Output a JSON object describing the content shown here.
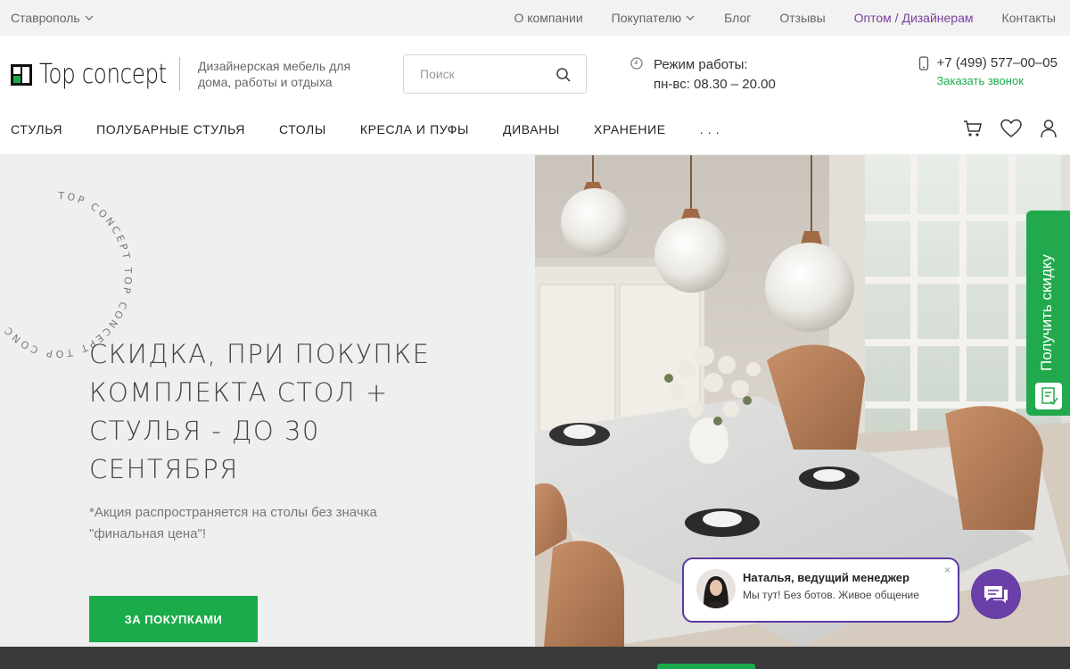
{
  "topbar": {
    "city": "Ставрополь",
    "nav": [
      "О компании",
      "Покупателю",
      "Блог",
      "Отзывы",
      "Оптом / Дизайнерам",
      "Контакты"
    ]
  },
  "header": {
    "logo_text": "Top concept",
    "tagline": "Дизайнерская мебель для дома, работы и отдыха",
    "search_placeholder": "Поиск",
    "hours_label": "Режим работы:",
    "hours_value": "пн-вс: 08.30 – 20.00",
    "phone": "+7 (499) 577–00–05",
    "callback": "Заказать звонок"
  },
  "catnav": {
    "items": [
      "СТУЛЬЯ",
      "ПОЛУБАРНЫЕ СТУЛЬЯ",
      "СТОЛЫ",
      "КРЕСЛА И ПУФЫ",
      "ДИВАНЫ",
      "ХРАНЕНИЕ",
      ". . ."
    ]
  },
  "hero": {
    "ring_text": "TOP CONCEPT TOP CONCEPT TOP CONC",
    "title": "СКИДКА, ПРИ ПОКУПКЕ КОМПЛЕКТА СТОЛ + СТУЛЬЯ - ДО 30 СЕНТЯБРЯ",
    "note": "*Акция распространяется на столы без значка \"финальная цена\"!",
    "cta": "ЗА ПОКУПКАМИ"
  },
  "discount_tab": {
    "label": "Получить скидку"
  },
  "chat": {
    "name": "Наталья, ведущий менеджер",
    "message": "Мы тут! Без ботов. Живое общение",
    "close": "×"
  },
  "colors": {
    "accent_green": "#1aab4b",
    "accent_purple": "#7b3fa0",
    "chat_purple": "#6b3fa8"
  }
}
